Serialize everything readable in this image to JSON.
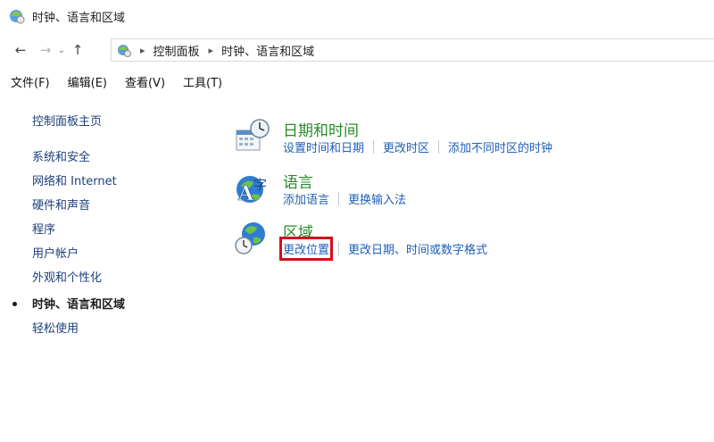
{
  "window": {
    "title": "时钟、语言和区域"
  },
  "address": {
    "crumbs": [
      "控制面板",
      "时钟、语言和区域"
    ]
  },
  "menu": [
    "文件(F)",
    "编辑(E)",
    "查看(V)",
    "工具(T)"
  ],
  "sidebar": {
    "home": "控制面板主页",
    "items": [
      "系统和安全",
      "网络和 Internet",
      "硬件和声音",
      "程序",
      "用户帐户",
      "外观和个性化",
      "时钟、语言和区域",
      "轻松使用"
    ],
    "current_index": 6
  },
  "sections": [
    {
      "icon": "calendar-clock-icon",
      "title": "日期和时间",
      "links": [
        "设置时间和日期",
        "更改时区",
        "添加不同时区的时钟"
      ]
    },
    {
      "icon": "language-icon",
      "title": "语言",
      "links": [
        "添加语言",
        "更换输入法"
      ]
    },
    {
      "icon": "globe-clock-icon",
      "title": "区域",
      "links": [
        "更改位置",
        "更改日期、时间或数字格式"
      ],
      "highlighted_link_index": 0
    }
  ],
  "colors": {
    "heading": "#2a8a2a",
    "link": "#1f5fb8",
    "highlight": "#d0101a"
  }
}
